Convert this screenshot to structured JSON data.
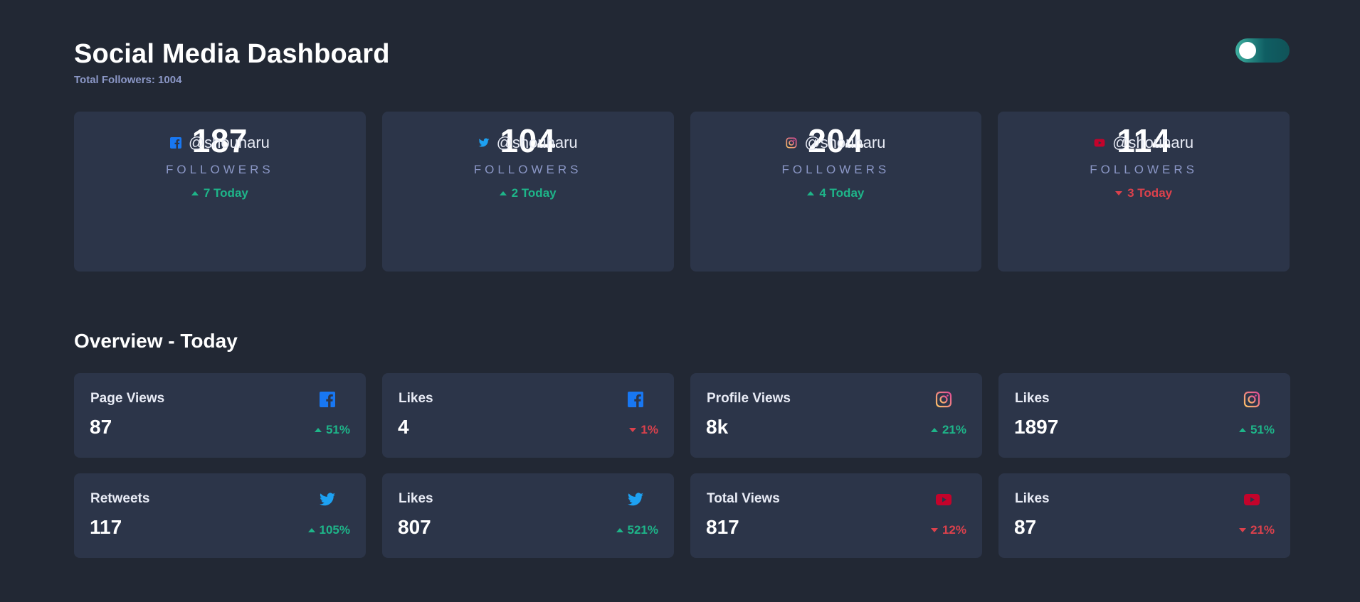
{
  "header": {
    "title": "Social Media Dashboard",
    "total_label": "Total Followers: 1004",
    "toggle_state": "dark"
  },
  "followers": [
    {
      "platform": "facebook",
      "icon": "facebook-icon",
      "color": "#1877f2",
      "handle": "@shouharu",
      "count": "187",
      "label": "FOLLOWERS",
      "trend": "up",
      "change": "7 Today"
    },
    {
      "platform": "twitter",
      "icon": "twitter-icon",
      "color": "#1da1f2",
      "handle": "@shouharu",
      "count": "104",
      "label": "FOLLOWERS",
      "trend": "up",
      "change": "2 Today"
    },
    {
      "platform": "instagram",
      "icon": "instagram-icon",
      "color": "#c13584",
      "handle": "@shouharu",
      "count": "204",
      "label": "FOLLOWERS",
      "trend": "up",
      "change": "4 Today"
    },
    {
      "platform": "youtube",
      "icon": "youtube-icon",
      "color": "#c4032b",
      "handle": "@shouharu",
      "count": "114",
      "label": "FOLLOWERS",
      "trend": "down",
      "change": "3 Today"
    }
  ],
  "overview": {
    "title": "Overview - Today",
    "cards": [
      {
        "metric": "Page Views",
        "platform": "facebook",
        "icon": "facebook-icon",
        "value": "87",
        "trend": "up",
        "percent": "51%"
      },
      {
        "metric": "Likes",
        "platform": "facebook",
        "icon": "facebook-icon",
        "value": "4",
        "trend": "down",
        "percent": "1%"
      },
      {
        "metric": "Profile Views",
        "platform": "instagram",
        "icon": "instagram-icon",
        "value": "8k",
        "trend": "up",
        "percent": "21%"
      },
      {
        "metric": "Likes",
        "platform": "instagram",
        "icon": "instagram-icon",
        "value": "1897",
        "trend": "up",
        "percent": "51%"
      },
      {
        "metric": "Retweets",
        "platform": "twitter",
        "icon": "twitter-icon",
        "value": "117",
        "trend": "up",
        "percent": "105%"
      },
      {
        "metric": "Likes",
        "platform": "twitter",
        "icon": "twitter-icon",
        "value": "807",
        "trend": "up",
        "percent": "521%"
      },
      {
        "metric": "Total Views",
        "platform": "youtube",
        "icon": "youtube-icon",
        "value": "817",
        "trend": "down",
        "percent": "12%"
      },
      {
        "metric": "Likes",
        "platform": "youtube",
        "icon": "youtube-icon",
        "value": "87",
        "trend": "down",
        "percent": "21%"
      }
    ]
  },
  "colors": {
    "background": "#222834",
    "card": "#2c3549",
    "up": "#1eb589",
    "down": "#dc414c",
    "muted": "#8b97c6"
  }
}
